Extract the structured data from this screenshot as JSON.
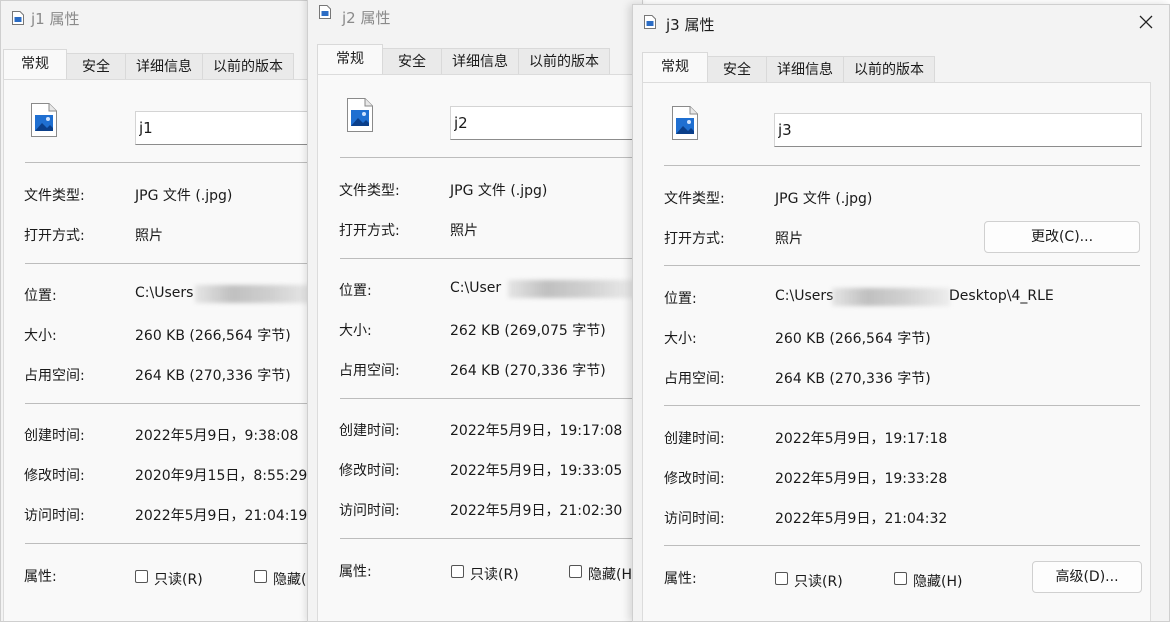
{
  "tabs": [
    "常规",
    "安全",
    "详细信息",
    "以前的版本"
  ],
  "labels": {
    "file_type": "文件类型:",
    "open_with": "打开方式:",
    "location": "位置:",
    "size": "大小:",
    "size_on_disk": "占用空间:",
    "created": "创建时间:",
    "modified": "修改时间:",
    "accessed": "访问时间:",
    "attributes": "属性:",
    "readonly": "只读(R)",
    "hidden_partial": "隐藏(",
    "hidden_partial2": "隐藏(H",
    "hidden": "隐藏(H)"
  },
  "buttons": {
    "change": "更改(C)...",
    "advanced": "高级(D)..."
  },
  "colors": {
    "window_bg": "#f3f3f3",
    "panel_bg": "#f9f9f9",
    "separator": "#bdbdbd"
  },
  "windows": [
    {
      "title": "j1 属性",
      "name": "j1",
      "file_type": "JPG 文件 (.jpg)",
      "open_with": "照片",
      "location": "C:\\Users",
      "size": "260 KB (266,564 字节)",
      "size_on_disk": "264 KB (270,336 字节)",
      "created": "2022年5月9日，9:38:08",
      "modified": "2020年9月15日，8:55:29",
      "accessed": "2022年5月9日，21:04:19"
    },
    {
      "title": "j2 属性",
      "name": "j2",
      "file_type": "JPG 文件 (.jpg)",
      "open_with": "照片",
      "location": "C:\\User",
      "size": "262 KB (269,075 字节)",
      "size_on_disk": "264 KB (270,336 字节)",
      "created": "2022年5月9日，19:17:08",
      "modified": "2022年5月9日，19:33:05",
      "accessed": "2022年5月9日，21:02:30"
    },
    {
      "title": "j3 属性",
      "name": "j3",
      "file_type": "JPG 文件 (.jpg)",
      "open_with": "照片",
      "location": "C:\\Users",
      "location_tail": "Desktop\\4_RLE",
      "size": "260 KB (266,564 字节)",
      "size_on_disk": "264 KB (270,336 字节)",
      "created": "2022年5月9日，19:17:18",
      "modified": "2022年5月9日，19:33:28",
      "accessed": "2022年5月9日，21:04:32"
    }
  ]
}
